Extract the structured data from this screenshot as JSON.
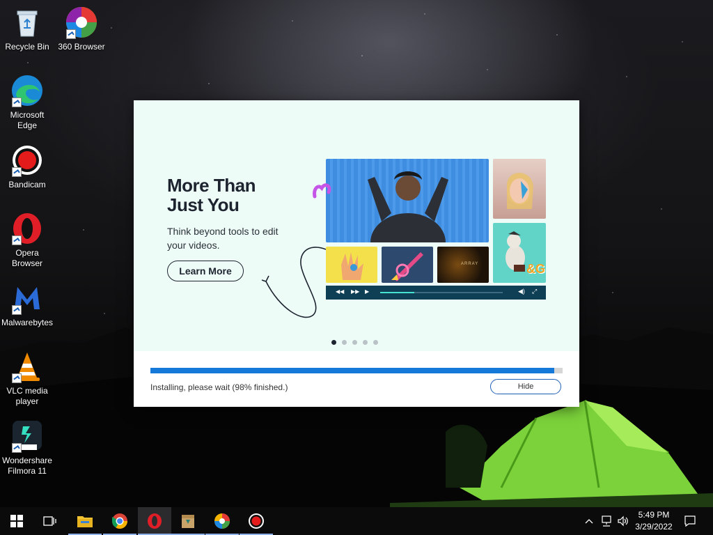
{
  "desktop": {
    "icons": [
      {
        "label": "Recycle Bin"
      },
      {
        "label": "360 Browser"
      },
      {
        "label": "Microsoft Edge"
      },
      {
        "label": "Bandicam"
      },
      {
        "label": "Opera Browser"
      },
      {
        "label": "Malwarebytes"
      },
      {
        "label": "VLC media player"
      },
      {
        "label": "Wondershare Filmora 11"
      }
    ]
  },
  "installer": {
    "headline_line1": "More Than",
    "headline_line2": "Just You",
    "subtext": "Think beyond tools to edit your videos.",
    "learn_more_label": "Learn More",
    "preview_thumb_text": "ARRAY",
    "preview_sticker_text": "&G!",
    "carousel": {
      "count": 5,
      "active_index": 0
    },
    "progress_percent": 98,
    "status_text": "Installing, please wait (98% finished.)",
    "hide_label": "Hide"
  },
  "taskbar": {
    "apps": [
      "start",
      "task-view",
      "file-explorer",
      "chrome",
      "opera",
      "filmora-installer",
      "360-browser",
      "bandicam"
    ],
    "time": "5:49 PM",
    "date": "3/29/2022"
  },
  "colors": {
    "accent": "#1479d9",
    "installer_bg": "#eefcf8",
    "headline": "#1d2430",
    "tent": "#7bd23a"
  }
}
